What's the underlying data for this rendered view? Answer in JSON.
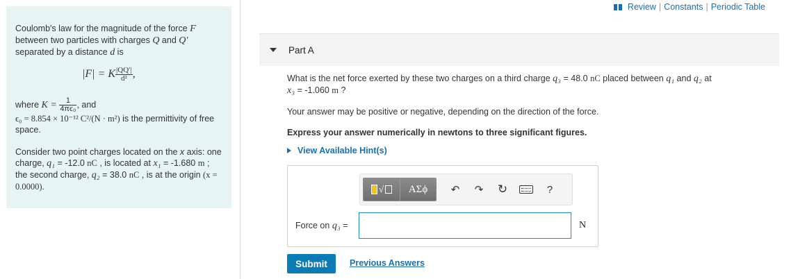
{
  "toplinks": {
    "review": "Review",
    "sep1": "|",
    "constants": "Constants",
    "sep2": "|",
    "periodic": "Periodic Table"
  },
  "info": {
    "p1_a": "Coulomb's law for the magnitude of the force ",
    "p1_F": "F",
    "p1_b": " between two particles with charges ",
    "p1_Q": "Q",
    "p1_c": " and ",
    "p1_Qp": "Q′",
    "p1_d": " separated by a distance ",
    "p1_dvar": "d",
    "p1_e": " is",
    "formula_lhs": "|F| = K",
    "formula_num": "|QQ′|",
    "formula_den": "d²",
    "formula_end": ",",
    "where": "where ",
    "K_eq": "K =",
    "K_num": "1",
    "K_den": "4πϵ₀",
    "and": ", and",
    "eps_def": "ϵ₀ = 8.854 × 10⁻¹² C²/(N · m²)",
    "eps_tail": " is the permittivity of free space.",
    "p3_a": "Consider two point charges located on the ",
    "p3_x": "x",
    "p3_b": " axis: one charge, ",
    "q1": "q₁",
    "q1_val": " = -12.0 ",
    "nC1": "nC",
    "p3_c": " , is located at ",
    "x1": "x₁",
    "x1_val": " = -1.680 ",
    "m1": "m",
    "p3_d": " ; the second charge, ",
    "q2": "q₂",
    "q2_val": " = 38.0 ",
    "nC2": "nC",
    "p3_e": " , is at the origin ",
    "origin": "(x = 0.0000)",
    "p3_f": "."
  },
  "part": {
    "title": "Part A"
  },
  "question": {
    "q1_a": "What is the net force exerted by these two charges on a third charge ",
    "q3": "q₃",
    "q1_b": " = 48.0 ",
    "nC": "nC",
    "q1_c": " placed between ",
    "q1v": "q₁",
    "q1_d": " and ",
    "q2v": "q₂",
    "q1_e": " at",
    "x3": "x₃",
    "x3_val": " = -1.060 ",
    "m": "m",
    "x3_end": " ?",
    "line2": "Your answer may be positive or negative, depending on the direction of the force.",
    "line3": "Express your answer numerically in newtons to three significant figures."
  },
  "hints": {
    "label": "View Available Hint(s)"
  },
  "toolbar": {
    "sqrt_glyph": "√",
    "greek_label": "ΑΣϕ",
    "undo_glyph": "↶",
    "redo_glyph": "↷",
    "reset_glyph": "↻",
    "help_glyph": "?"
  },
  "answer": {
    "label_a": "Force on ",
    "label_var": "q₃",
    "label_b": " =",
    "value": "",
    "unit": "N"
  },
  "actions": {
    "submit": "Submit",
    "previous": "Previous Answers"
  },
  "colors": {
    "info_bg": "#e6f4f4",
    "link": "#1a6fb0",
    "submit_bg": "#0b7bb5",
    "input_border": "#1a8fc7"
  }
}
